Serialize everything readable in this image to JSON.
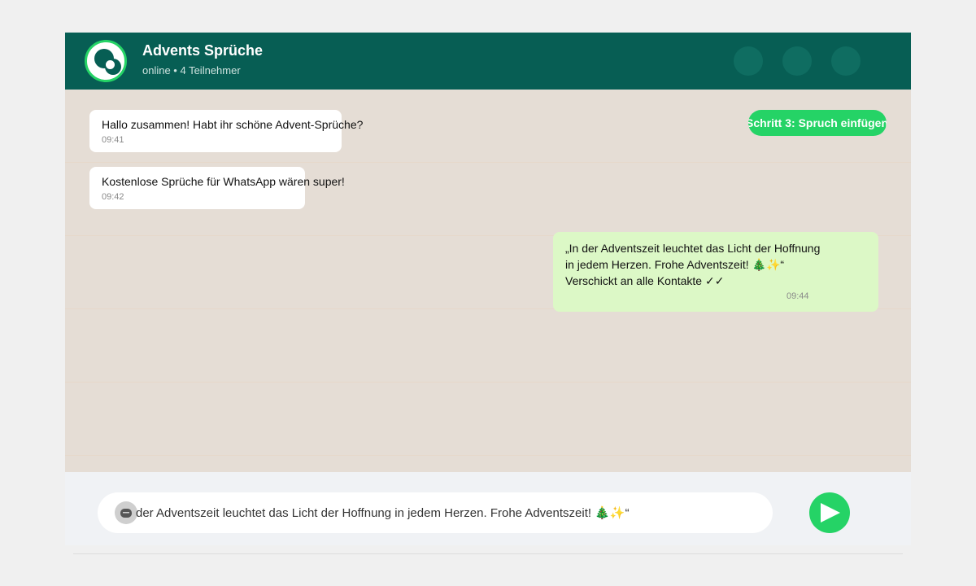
{
  "header": {
    "title": "Advents Sprüche",
    "subtitle": "online • 4 Teilnehmer",
    "avatar_icon": "group-avatar-icon",
    "action_icons": [
      "header-action-icon",
      "header-action-icon",
      "header-action-icon"
    ]
  },
  "messages": [
    {
      "direction": "incoming",
      "lines": [
        "Hallo zusammen! Habt ihr schöne Advent-Sprüche?"
      ],
      "time": "09:41"
    },
    {
      "direction": "incoming",
      "lines": [
        "Kostenlose Sprüche für WhatsApp wären super!"
      ],
      "time": "09:42"
    },
    {
      "direction": "outgoing",
      "lines": [
        "„In der Adventszeit leuchtet das Licht der Hoffnung",
        "in jedem Herzen. Frohe Adventszeit! 🎄✨“",
        "Verschickt an alle Kontakte ✓✓"
      ],
      "time": "09:44"
    }
  ],
  "step_badge": {
    "label": "Schritt 3: Spruch einfügen"
  },
  "composer": {
    "value": "der Adventszeit leuchtet das Licht der Hoffnung in jedem Herzen. Frohe Adventszeit! 🎄✨“",
    "emoji_icon": "emoji-icon",
    "send_icon": "send-icon"
  },
  "colors": {
    "header": "#075e54",
    "accent": "#25d366",
    "chat_background": "#e5ddd5",
    "incoming_bubble": "#ffffff",
    "outgoing_bubble": "#dcf8c6",
    "footer": "#f0f2f5"
  }
}
